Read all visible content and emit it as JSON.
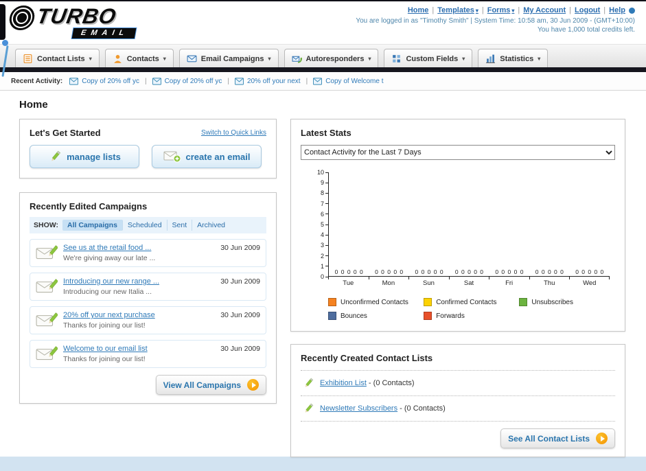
{
  "header": {
    "logo_line1": "TURBO",
    "logo_line2": "EMAIL",
    "top_links": [
      {
        "label": "Home"
      },
      {
        "label": "Templates"
      },
      {
        "label": "Forms"
      },
      {
        "label": "My Account"
      },
      {
        "label": "Logout"
      },
      {
        "label": "Help"
      }
    ],
    "login_info": "You are logged in as \"Timothy Smith\" | System Time: 10:58 am, 30 Jun 2009 - (GMT+10:00)",
    "credits": "You have 1,000 total credits left."
  },
  "nav": {
    "tabs": [
      {
        "label": "Contact Lists"
      },
      {
        "label": "Contacts"
      },
      {
        "label": "Email Campaigns"
      },
      {
        "label": "Autoresponders"
      },
      {
        "label": "Custom Fields"
      },
      {
        "label": "Statistics"
      }
    ]
  },
  "recent_activity": {
    "label": "Recent Activity:",
    "items": [
      {
        "label": "Copy of 20% off yc"
      },
      {
        "label": "Copy of 20% off yc"
      },
      {
        "label": "20% off your next"
      },
      {
        "label": "Copy of Welcome t"
      }
    ]
  },
  "page_title": "Home",
  "get_started": {
    "title": "Let's Get Started",
    "switch_link": "Switch to Quick Links",
    "buttons": [
      {
        "label": "manage lists"
      },
      {
        "label": "create an email"
      }
    ]
  },
  "campaigns": {
    "title": "Recently Edited Campaigns",
    "show_label": "SHOW:",
    "tabs": [
      "All Campaigns",
      "Scheduled",
      "Sent",
      "Archived"
    ],
    "items": [
      {
        "title": "See us at the retail food ...",
        "subtitle": "We're giving away our late ...",
        "date": "30 Jun 2009"
      },
      {
        "title": "Introducing our new range ...",
        "subtitle": "Introducing our new Italia ...",
        "date": "30 Jun 2009"
      },
      {
        "title": "20% off your next purchase",
        "subtitle": "Thanks for joining our list!",
        "date": "30 Jun 2009"
      },
      {
        "title": "Welcome to our email list",
        "subtitle": "Thanks for joining our list!",
        "date": "30 Jun 2009"
      }
    ],
    "view_all_label": "View All Campaigns"
  },
  "stats": {
    "title": "Latest Stats",
    "dropdown_value": "Contact Activity for the Last 7 Days",
    "chart_data": {
      "type": "bar",
      "title": "Contact Activity for the Last 7 Days",
      "categories": [
        "Tue",
        "Mon",
        "Sun",
        "Sat",
        "Fri",
        "Thu",
        "Wed"
      ],
      "series": [
        {
          "name": "Unconfirmed Contacts",
          "color": "#f58220",
          "values": [
            0,
            0,
            0,
            0,
            0,
            0,
            0
          ]
        },
        {
          "name": "Confirmed Contacts",
          "color": "#fcd202",
          "values": [
            0,
            0,
            0,
            0,
            0,
            0,
            0
          ]
        },
        {
          "name": "Unsubscribes",
          "color": "#6cb33f",
          "values": [
            0,
            0,
            0,
            0,
            0,
            0,
            0
          ]
        },
        {
          "name": "Bounces",
          "color": "#4e6d9e",
          "values": [
            0,
            0,
            0,
            0,
            0,
            0,
            0
          ]
        },
        {
          "name": "Forwards",
          "color": "#e8502a",
          "values": [
            0,
            0,
            0,
            0,
            0,
            0,
            0
          ]
        }
      ],
      "ylim": [
        0,
        10
      ],
      "ytick_step": 1,
      "grid": false,
      "legend_position": "bottom"
    }
  },
  "contact_lists": {
    "title": "Recently Created Contact Lists",
    "items": [
      {
        "name": "Exhibition List",
        "suffix": " - (0 Contacts)"
      },
      {
        "name": "Newsletter Subscribers",
        "suffix": " - (0 Contacts)"
      }
    ],
    "see_all_label": "See All Contact Lists"
  }
}
